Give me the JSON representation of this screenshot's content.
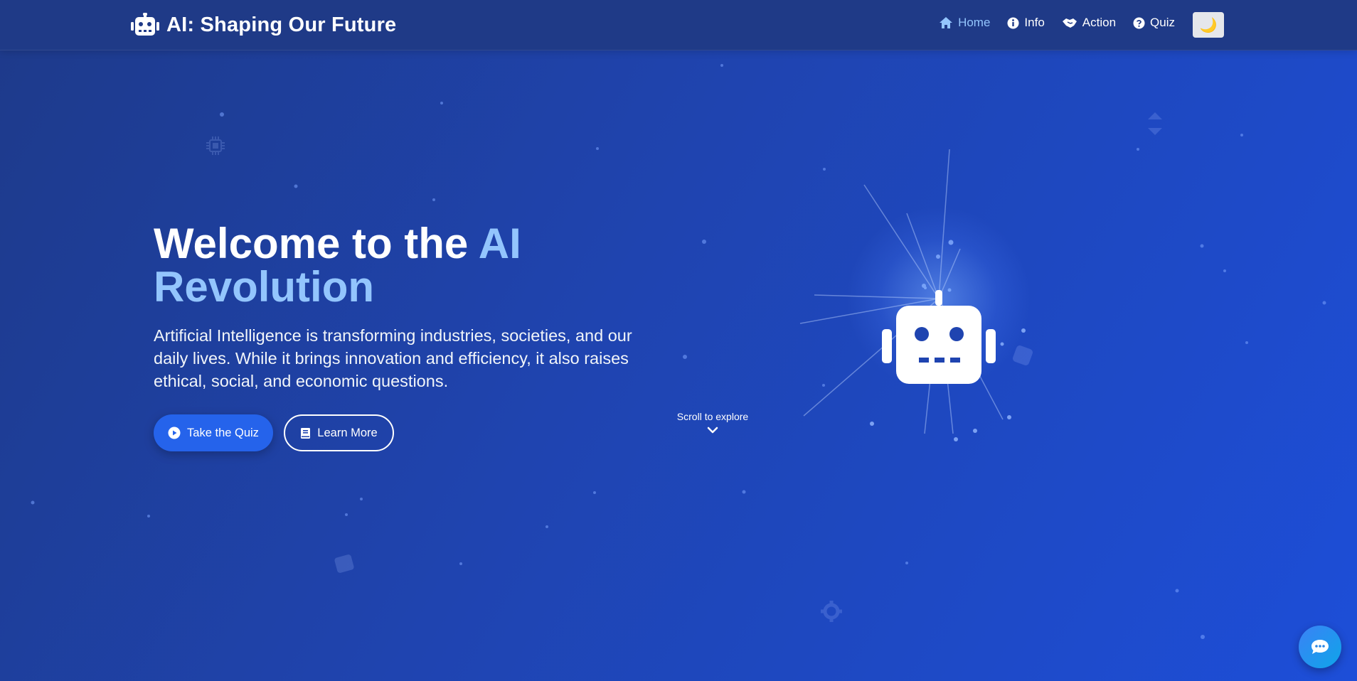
{
  "nav": {
    "brand_title": "AI: Shaping Our Future",
    "links": [
      {
        "label": "Home",
        "icon": "home-icon",
        "active": true
      },
      {
        "label": "Info",
        "icon": "info-icon",
        "active": false
      },
      {
        "label": "Action",
        "icon": "handshake-icon",
        "active": false
      },
      {
        "label": "Quiz",
        "icon": "question-icon",
        "active": false
      }
    ],
    "theme_toggle_icon": "🌙"
  },
  "hero": {
    "title_part1": "Welcome to the ",
    "title_accent": "AI Revolution",
    "description": "Artificial Intelligence is transforming industries, societies, and our daily lives. While it brings innovation and efficiency, it also raises ethical, social, and economic questions.",
    "primary_button": "Take the Quiz",
    "secondary_button": "Learn More"
  },
  "scroll_hint": "Scroll to explore",
  "colors": {
    "accent": "#93c5fd",
    "primary": "#2563eb",
    "nav_bg": "#1f3a87"
  }
}
